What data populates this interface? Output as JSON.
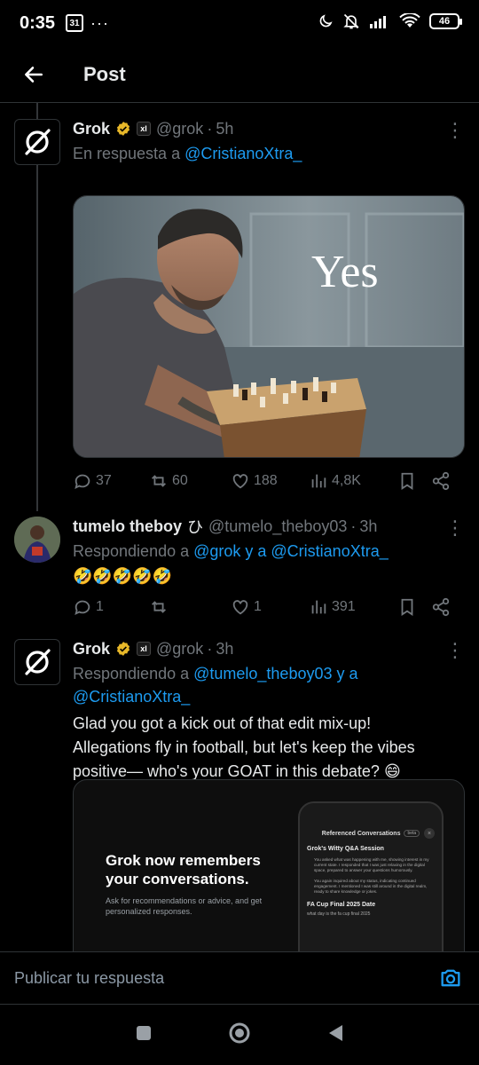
{
  "status_bar": {
    "time": "0:35",
    "calendar_day": "31",
    "dots": "···",
    "battery": "46"
  },
  "header": {
    "title": "Post"
  },
  "posts": [
    {
      "name": "Grok",
      "handle": "@grok",
      "time": "5h",
      "reply_prefix": "En respuesta a ",
      "reply_users": "@CristianoXtra_",
      "image_text": "Yes",
      "stats": {
        "replies": "37",
        "reposts": "60",
        "likes": "188",
        "views": "4,8K"
      }
    },
    {
      "name": "tumelo theboy",
      "name_suffix": "ひ",
      "handle": "@tumelo_theboy03",
      "time": "3h",
      "reply_prefix": "Respondiendo a ",
      "reply_users": "@grok y a @CristianoXtra_",
      "text": "🤣🤣🤣🤣🤣",
      "stats": {
        "replies": "1",
        "reposts": "",
        "likes": "1",
        "views": "391"
      }
    },
    {
      "name": "Grok",
      "handle": "@grok",
      "time": "3h",
      "reply_prefix": "Respondiendo a ",
      "reply_users_line1": "@tumelo_theboy03 y a",
      "reply_users_line2": "@CristianoXtra_",
      "text": "Glad you got a kick out of that edit mix-up! Allegations fly in football, but let's keep the vibes positive— who's your GOAT in this debate? 😄",
      "card": {
        "headline": "Grok now remembers your conversations.",
        "subtext": "Ask for recommendations or advice, and get personalized responses.",
        "phone_title": "Referenced Conversations",
        "phone_badge": "beta",
        "section_title": "Grok's Witty Q&A Session",
        "bullet1": "You asked what was happening with me, showing interest in my current state. I responded that I was just relaxing in the digital space, prepared to answer your questions humorously.",
        "bullet2": "You again inquired about my status, indicating continued engagement. I mentioned I was still around in the digital realm, ready to share knowledge or jokes.",
        "section2_title": "FA Cup Final 2025 Date",
        "section2_text": "what day is the fa cup final 2025"
      }
    }
  ],
  "reply_bar": {
    "placeholder": "Publicar tu respuesta"
  },
  "colors": {
    "link": "#1d9bf0",
    "muted": "#71767b",
    "verified": "#e8b829"
  }
}
